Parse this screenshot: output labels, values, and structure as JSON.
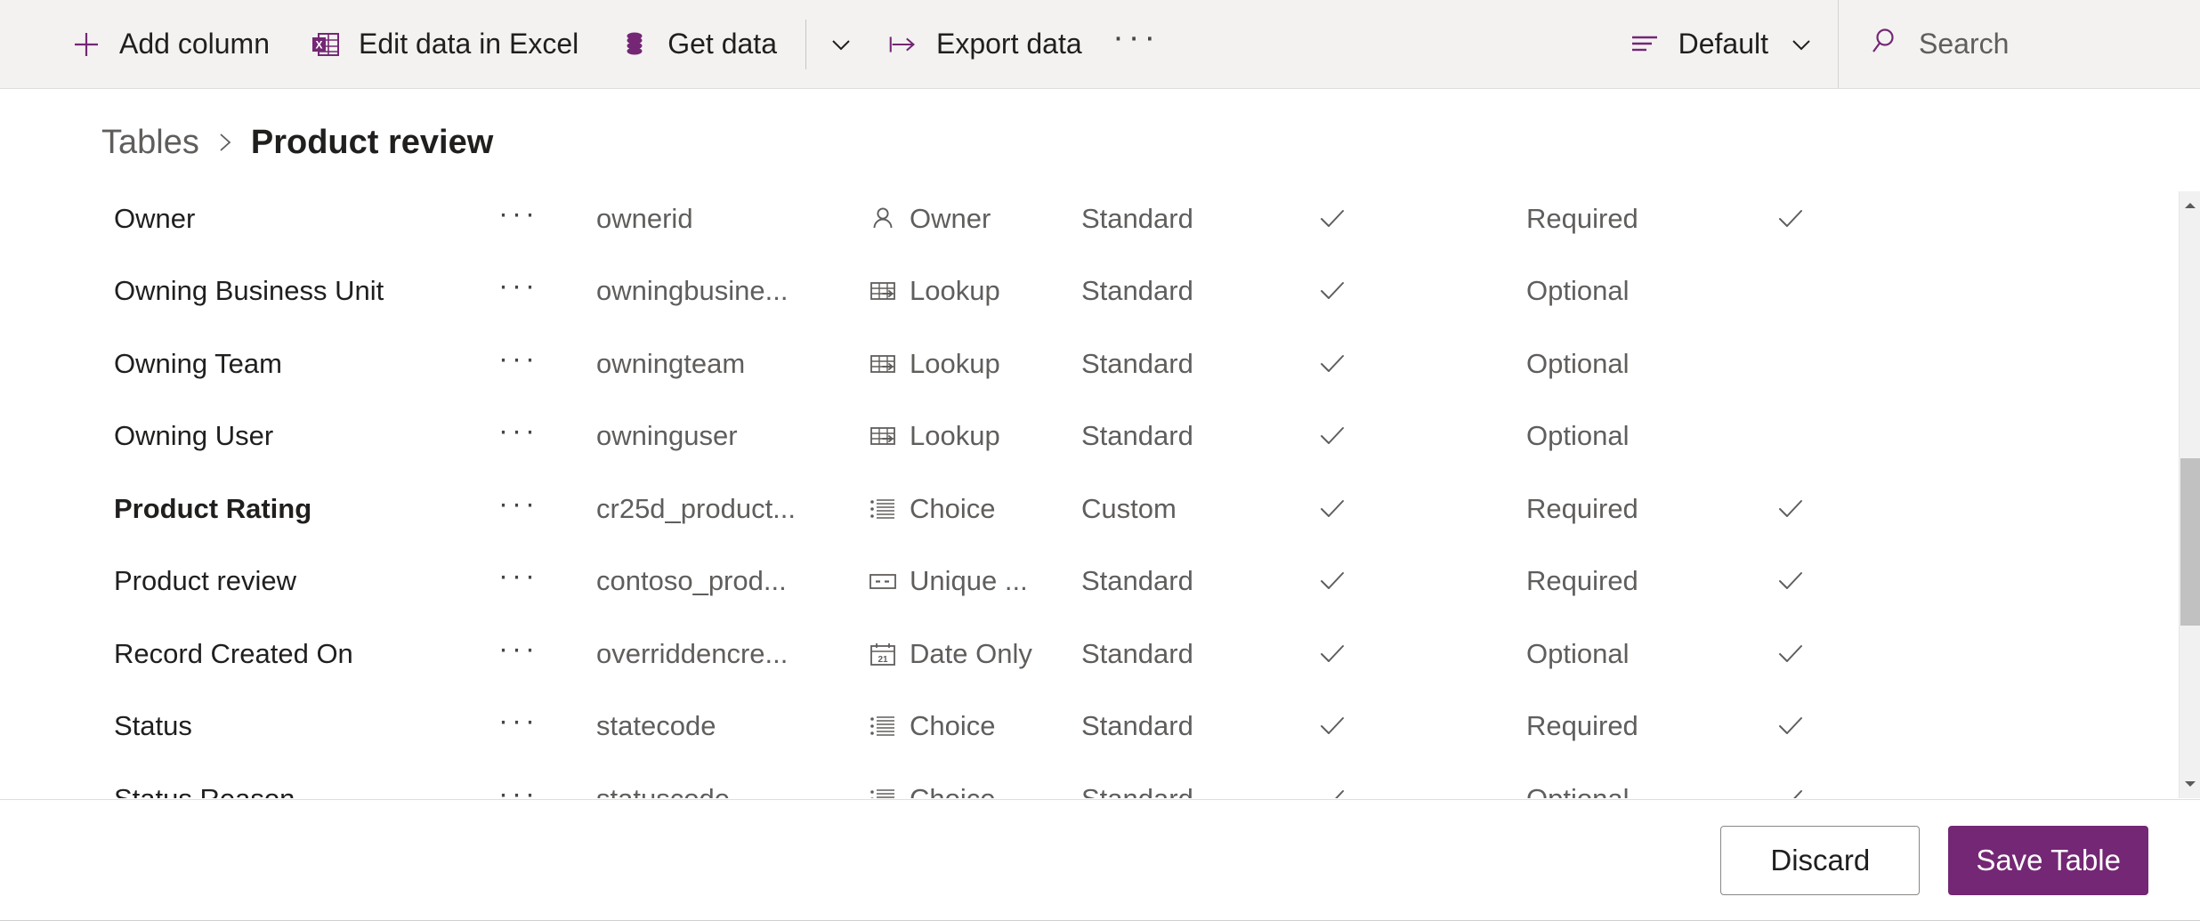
{
  "commandbar": {
    "items": [
      {
        "id": "add-column",
        "label": "Add column",
        "icon": "plus-icon"
      },
      {
        "id": "edit-data-in-excel",
        "label": "Edit data in Excel",
        "icon": "excel-icon"
      },
      {
        "id": "get-data",
        "label": "Get data",
        "icon": "database-icon"
      },
      {
        "id": "export-data",
        "label": "Export data",
        "icon": "export-arrow-icon"
      }
    ],
    "get_data_chevron": "chevron-down-icon",
    "overflow": {
      "id": "more-commands",
      "label": "···",
      "icon": "more-horizontal-icon"
    },
    "view_selector": {
      "id": "view-default",
      "label": "Default",
      "icon": "view-list-icon",
      "chevron": "chevron-down-icon"
    },
    "search": {
      "id": "search",
      "placeholder": "Search",
      "value": "",
      "icon": "search-icon"
    }
  },
  "breadcrumb": {
    "parent": "Tables",
    "separator": "›",
    "current": "Product review"
  },
  "grid": {
    "row_menu_glyph": "···",
    "check_glyph": "✓",
    "rows": [
      {
        "display_name": "Owner",
        "name": "ownerid",
        "data_type": "Owner",
        "type_icon": "person-icon",
        "customization": "Standard",
        "searchable": true,
        "requirement": "Required",
        "managed": true,
        "modified": false
      },
      {
        "display_name": "Owning Business Unit",
        "name": "owningbusine...",
        "data_type": "Lookup",
        "type_icon": "lookup-icon",
        "customization": "Standard",
        "searchable": true,
        "requirement": "Optional",
        "managed": false,
        "modified": false
      },
      {
        "display_name": "Owning Team",
        "name": "owningteam",
        "data_type": "Lookup",
        "type_icon": "lookup-icon",
        "customization": "Standard",
        "searchable": true,
        "requirement": "Optional",
        "managed": false,
        "modified": false
      },
      {
        "display_name": "Owning User",
        "name": "owninguser",
        "data_type": "Lookup",
        "type_icon": "lookup-icon",
        "customization": "Standard",
        "searchable": true,
        "requirement": "Optional",
        "managed": false,
        "modified": false
      },
      {
        "display_name": "Product Rating",
        "name": "cr25d_product...",
        "data_type": "Choice",
        "type_icon": "choice-icon",
        "customization": "Custom",
        "searchable": true,
        "requirement": "Required",
        "managed": true,
        "modified": true
      },
      {
        "display_name": "Product review",
        "name": "contoso_prod...",
        "data_type": "Unique ...",
        "type_icon": "unique-identifier-icon",
        "customization": "Standard",
        "searchable": true,
        "requirement": "Required",
        "managed": true,
        "modified": false
      },
      {
        "display_name": "Record Created On",
        "name": "overriddencre...",
        "data_type": "Date Only",
        "type_icon": "calendar-icon",
        "customization": "Standard",
        "searchable": true,
        "requirement": "Optional",
        "managed": true,
        "modified": false
      },
      {
        "display_name": "Status",
        "name": "statecode",
        "data_type": "Choice",
        "type_icon": "choice-icon",
        "customization": "Standard",
        "searchable": true,
        "requirement": "Required",
        "managed": true,
        "modified": false
      },
      {
        "display_name": "Status Reason",
        "name": "statuscode",
        "data_type": "Choice",
        "type_icon": "choice-icon",
        "customization": "Standard",
        "searchable": true,
        "requirement": "Optional",
        "managed": true,
        "modified": false
      }
    ]
  },
  "scrollbar": {
    "up_arrow": "scroll-up-icon",
    "down_arrow": "scroll-down-icon"
  },
  "footer": {
    "discard_label": "Discard",
    "save_label": "Save Table"
  },
  "colors": {
    "accent": "#742774",
    "commandbar_bg": "#f3f2f1",
    "text": "#201f1e",
    "text_secondary": "#605e5c"
  }
}
